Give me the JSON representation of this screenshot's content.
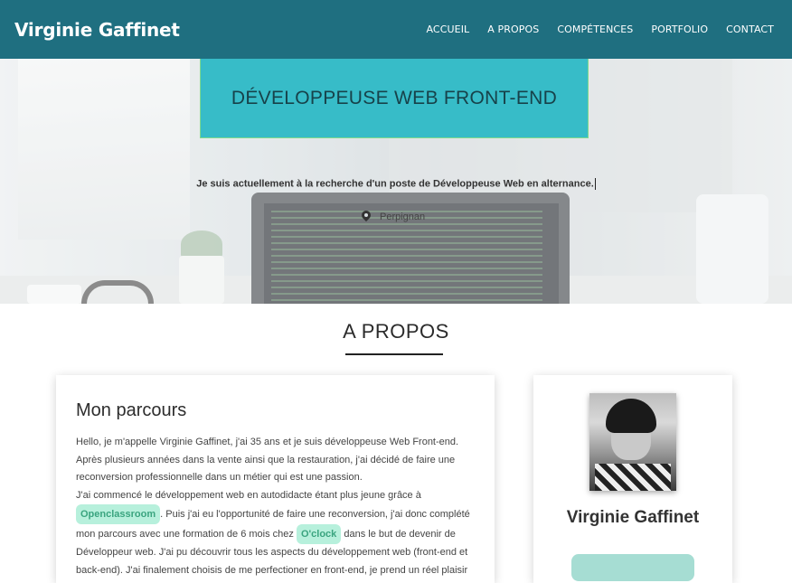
{
  "header": {
    "brand": "Virginie Gaffinet",
    "nav": [
      "ACCUEIL",
      "A PROPOS",
      "COMPÉTENCES",
      "PORTFOLIO",
      "CONTACT"
    ]
  },
  "hero": {
    "title": "DÉVELOPPEUSE WEB FRONT-END",
    "tagline": "Je suis actuellement à la recherche d'un poste de Développeuse Web en alternance.",
    "location_icon": "map-pin-icon",
    "location": "Perpignan"
  },
  "about": {
    "section_title": "A PROPOS",
    "card_title": "Mon parcours",
    "p1": "Hello, je m'appelle Virginie Gaffinet, j'ai 35 ans et je suis développeuse Web Front-end. Après plusieurs années dans la vente ainsi que la restauration, j'ai décidé de faire une reconversion professionnelle dans un métier qui est une passion.",
    "p2a": "J'ai commencé le développement web en autodidacte étant plus jeune grâce à",
    "chip1": "Openclassroom",
    "p2b": ". Puis j'ai eu l'opportunité de faire une reconversion, j'ai donc complété mon parcours avec une formation de 6 mois chez",
    "chip2": "O'clock",
    "p2c": "dans le but de devenir de Développeur web. J'ai pu découvrir tous les aspects du développement web (front-end et back-end). J'ai finalement choisis de me perfectioner en front-end, je prend un réel plaisir à",
    "profile_name": "Virginie Gaffinet"
  },
  "colors": {
    "nav_bg": "#1f6f80",
    "accent": "#37bcc8",
    "chip_bg": "#b7f0dc",
    "chip_text": "#3aa47f"
  }
}
